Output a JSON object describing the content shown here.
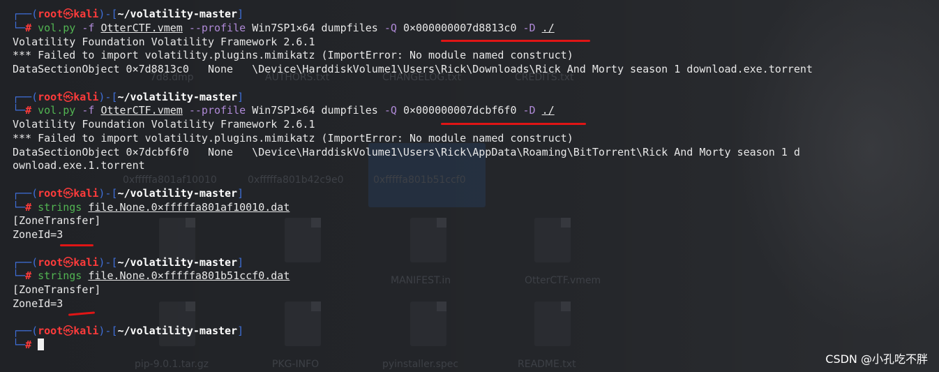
{
  "prompt": {
    "user": "root",
    "skull": "㉿",
    "host": "kali",
    "cwd": "~/volatility-master",
    "hash": "#"
  },
  "blocks": [
    {
      "cmd": {
        "program": "vol.py",
        "args": [
          {
            "t": "flag",
            "v": "-f"
          },
          {
            "t": "ul",
            "v": "OtterCTF.vmem"
          },
          {
            "t": "flag",
            "v": "--profile"
          },
          {
            "t": "plain",
            "v": "Win7SP1×64"
          },
          {
            "t": "plain",
            "v": "dumpfiles"
          },
          {
            "t": "flag",
            "v": "-Q"
          },
          {
            "t": "plain",
            "v": "0×000000007d8813c0"
          },
          {
            "t": "flag",
            "v": "-D"
          },
          {
            "t": "ul",
            "v": "./"
          }
        ]
      },
      "output": [
        "Volatility Foundation Volatility Framework 2.6.1",
        "*** Failed to import volatility.plugins.mimikatz (ImportError: No module named construct)",
        "DataSectionObject 0×7d8813c0   None   \\Device\\HarddiskVolume1\\Users\\Rick\\Downloads\\Rick And Morty season 1 download.exe.torrent"
      ]
    },
    {
      "cmd": {
        "program": "vol.py",
        "args": [
          {
            "t": "flag",
            "v": "-f"
          },
          {
            "t": "ul",
            "v": "OtterCTF.vmem"
          },
          {
            "t": "flag",
            "v": "--profile"
          },
          {
            "t": "plain",
            "v": "Win7SP1×64"
          },
          {
            "t": "plain",
            "v": "dumpfiles"
          },
          {
            "t": "flag",
            "v": "-Q"
          },
          {
            "t": "plain",
            "v": "0×000000007dcbf6f0"
          },
          {
            "t": "flag",
            "v": "-D"
          },
          {
            "t": "ul",
            "v": "./"
          }
        ]
      },
      "output": [
        "Volatility Foundation Volatility Framework 2.6.1",
        "*** Failed to import volatility.plugins.mimikatz (ImportError: No module named construct)",
        "DataSectionObject 0×7dcbf6f0   None   \\Device\\HarddiskVolume1\\Users\\Rick\\AppData\\Roaming\\BitTorrent\\Rick And Morty season 1 d",
        "ownload.exe.1.torrent"
      ]
    },
    {
      "cmd": {
        "program": "strings",
        "args": [
          {
            "t": "ul",
            "v": "file.None.0×fffffa801af10010.dat"
          }
        ]
      },
      "output": [
        "[ZoneTransfer]",
        "ZoneId=3"
      ]
    },
    {
      "cmd": {
        "program": "strings",
        "args": [
          {
            "t": "ul",
            "v": "file.None.0×fffffa801b51ccf0.dat"
          }
        ]
      },
      "output": [
        "[ZoneTransfer]",
        "ZoneId=3"
      ]
    }
  ],
  "desktop_labels": [
    "7d8.dmp",
    "AUTHORS.txt",
    "CHANGELOG.txt",
    "CREDITS.txt",
    "0xfffffa801af10010",
    "0xfffffa801b42c9e0",
    "0xfffffa801b51ccf0",
    "MANIFEST.in",
    "OtterCTF.vmem",
    "pip-9.0.1.tar.gz",
    "PKG-INFO",
    "pyinstaller.spec",
    "README.txt"
  ],
  "watermark": "CSDN @小孔吃不胖",
  "colors": {
    "prompt_frame": "#3f6fd9",
    "prompt_user": "#ff3b3b",
    "command": "#52b552",
    "flag": "#b08ad8",
    "annotation": "#e01515"
  }
}
